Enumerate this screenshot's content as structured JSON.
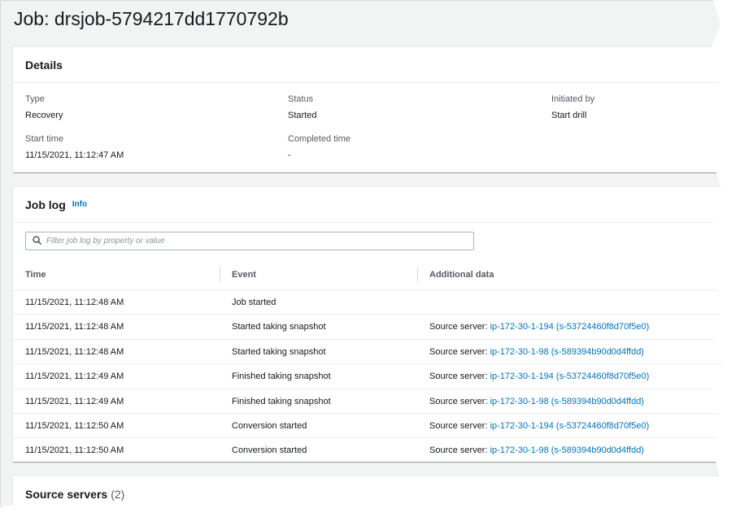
{
  "job": {
    "title": "Job: drsjob-5794217dd1770792b"
  },
  "details": {
    "title": "Details",
    "type_label": "Type",
    "type_value": "Recovery",
    "status_label": "Status",
    "status_value": "Started",
    "initiated_label": "Initiated by",
    "initiated_value": "Start drill",
    "start_label": "Start time",
    "start_value": "11/15/2021, 11:12:47 AM",
    "completed_label": "Completed time",
    "completed_value": "-"
  },
  "joblog": {
    "title": "Job log",
    "info": "Info",
    "search_placeholder": "Filter job log by property or value",
    "columns": [
      "Time",
      "Event",
      "Additional data"
    ],
    "rows": [
      {
        "time": "11/15/2021, 11:12:48 AM",
        "event": "Job started",
        "prefix": "",
        "link": ""
      },
      {
        "time": "11/15/2021, 11:12:48 AM",
        "event": "Started taking snapshot",
        "prefix": "Source server: ",
        "link": "ip-172-30-1-194 (s-53724460f8d70f5e0)"
      },
      {
        "time": "11/15/2021, 11:12:48 AM",
        "event": "Started taking snapshot",
        "prefix": "Source server: ",
        "link": "ip-172-30-1-98 (s-589394b90d0d4ffdd)"
      },
      {
        "time": "11/15/2021, 11:12:49 AM",
        "event": "Finished taking snapshot",
        "prefix": "Source server: ",
        "link": "ip-172-30-1-194 (s-53724460f8d70f5e0)"
      },
      {
        "time": "11/15/2021, 11:12:49 AM",
        "event": "Finished taking snapshot",
        "prefix": "Source server: ",
        "link": "ip-172-30-1-98 (s-589394b90d0d4ffdd)"
      },
      {
        "time": "11/15/2021, 11:12:50 AM",
        "event": "Conversion started",
        "prefix": "Source server: ",
        "link": "ip-172-30-1-194 (s-53724460f8d70f5e0)"
      },
      {
        "time": "11/15/2021, 11:12:50 AM",
        "event": "Conversion started",
        "prefix": "Source server: ",
        "link": "ip-172-30-1-98 (s-589394b90d0d4ffdd)"
      }
    ]
  },
  "sources": {
    "title": "Source servers",
    "count": "(2)"
  },
  "icons": {
    "search": "search-icon"
  },
  "colors": {
    "link": "#0073bb",
    "background": "#f2f3f3",
    "text": "#16191f",
    "muted": "#545b64"
  }
}
